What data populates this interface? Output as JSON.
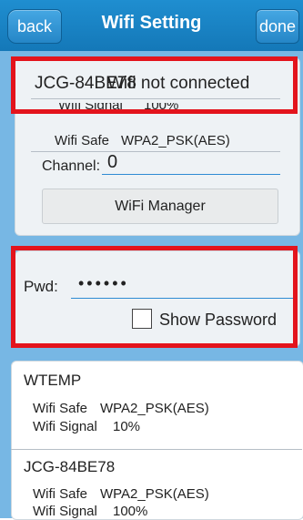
{
  "header": {
    "back_label": "back",
    "title": "Wifi Setting",
    "done_label": "done"
  },
  "current": {
    "ssid": "JCG-84BE78",
    "status": "Wifi not connected",
    "signal_label": "Wifi Signal",
    "signal_value": "100%",
    "safe_label": "Wifi Safe",
    "safe_value": "WPA2_PSK(AES)",
    "channel_label": "Channel:",
    "channel_value": "0",
    "manager_label": "WiFi Manager"
  },
  "password": {
    "label": "Pwd:",
    "value": "••••••",
    "show_label": "Show Password",
    "show_checked": false
  },
  "networks": [
    {
      "ssid": "WTEMP",
      "safe_label": "Wifi Safe",
      "safe_value": "WPA2_PSK(AES)",
      "signal_label": "Wifi Signal",
      "signal_value": "10%"
    },
    {
      "ssid": "JCG-84BE78",
      "safe_label": "Wifi Safe",
      "safe_value": "WPA2_PSK(AES)",
      "signal_label": "Wifi Signal",
      "signal_value": "100%"
    }
  ],
  "colors": {
    "accent": "#1f8ed0",
    "highlight": "#e3141c",
    "panel_bg": "#77b7e4"
  }
}
